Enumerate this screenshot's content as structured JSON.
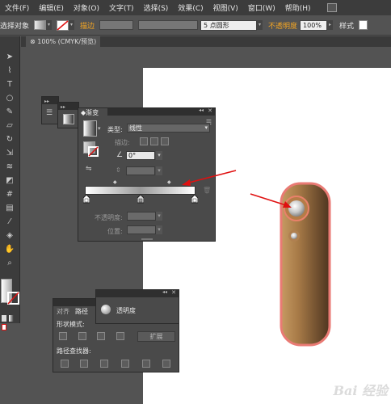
{
  "menu": {
    "items": [
      "文件(F)",
      "编辑(E)",
      "对象(O)",
      "文字(T)",
      "选择(S)",
      "效果(C)",
      "视图(V)",
      "窗口(W)",
      "帮助(H)"
    ]
  },
  "control_bar": {
    "selection_label": "选择对象",
    "stroke_label": "描边",
    "point_label": "5 点圆形",
    "opacity_label": "不透明度",
    "opacity_value": "100%",
    "style_label": "样式"
  },
  "document_tab": {
    "label": "100% (CMYK/预览)"
  },
  "gradient_panel": {
    "title": "渐变",
    "type_label": "类型",
    "type_value": "线性",
    "stroke_label": "描边",
    "angle_value": "0°",
    "opacity_label": "不透明度",
    "position_label": "位置"
  },
  "pathfinder_panel": {
    "tab_align": "对齐",
    "tab_pathfinder": "路径",
    "shape_modes_label": "形状模式",
    "expand_label": "扩展",
    "pathfinders_label": "路径查找器"
  },
  "transparency_panel": {
    "title": "透明度"
  },
  "watermark": {
    "text": "Bai 经验"
  },
  "colors": {
    "gradient_dark": "#5a3d22",
    "gradient_light": "#c79a62",
    "highlight_border": "#e97a74",
    "arrow": "#e01010",
    "accent_orange": "#f5a623"
  }
}
